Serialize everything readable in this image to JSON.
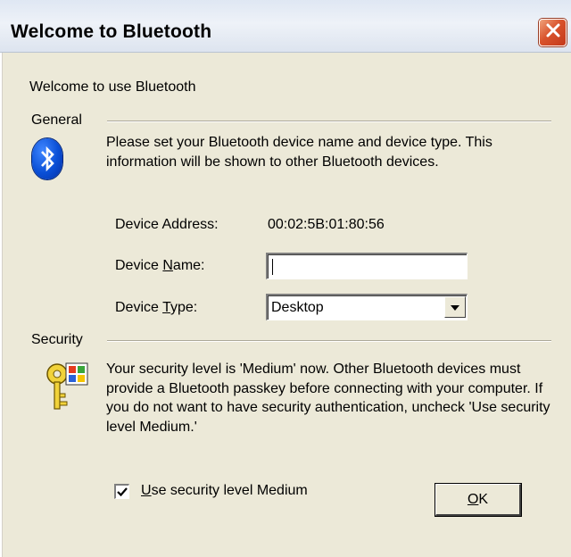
{
  "window": {
    "title": "Welcome to Bluetooth",
    "close_icon": "close-icon"
  },
  "intro": "Welcome to use Bluetooth",
  "general": {
    "heading": "General",
    "description": "Please set your Bluetooth device name and device type. This information will be shown to other Bluetooth devices.",
    "icon": "bluetooth-icon"
  },
  "device": {
    "address_label": "Device Address:",
    "address_value": "00:02:5B:01:80:56",
    "name_label_prefix": "Device ",
    "name_label_accel": "N",
    "name_label_suffix": "ame:",
    "name_value": "",
    "type_label_prefix": "Device ",
    "type_label_accel": "T",
    "type_label_suffix": "ype:",
    "type_selected": "Desktop"
  },
  "security": {
    "heading": "Security",
    "description": "Your security level is 'Medium' now. Other Bluetooth devices must provide a Bluetooth passkey before connecting with your computer. If you do not want to have security authentication, uncheck 'Use security level Medium.'",
    "icon": "key-icon",
    "checkbox_accel": "U",
    "checkbox_label_rest": "se security level Medium",
    "checkbox_checked": true
  },
  "buttons": {
    "ok_accel": "O",
    "ok_rest": "K"
  },
  "colors": {
    "dialog_bg": "#ece9d8",
    "bluetooth_blue": "#0a4fd6",
    "close_red": "#d9532c"
  }
}
